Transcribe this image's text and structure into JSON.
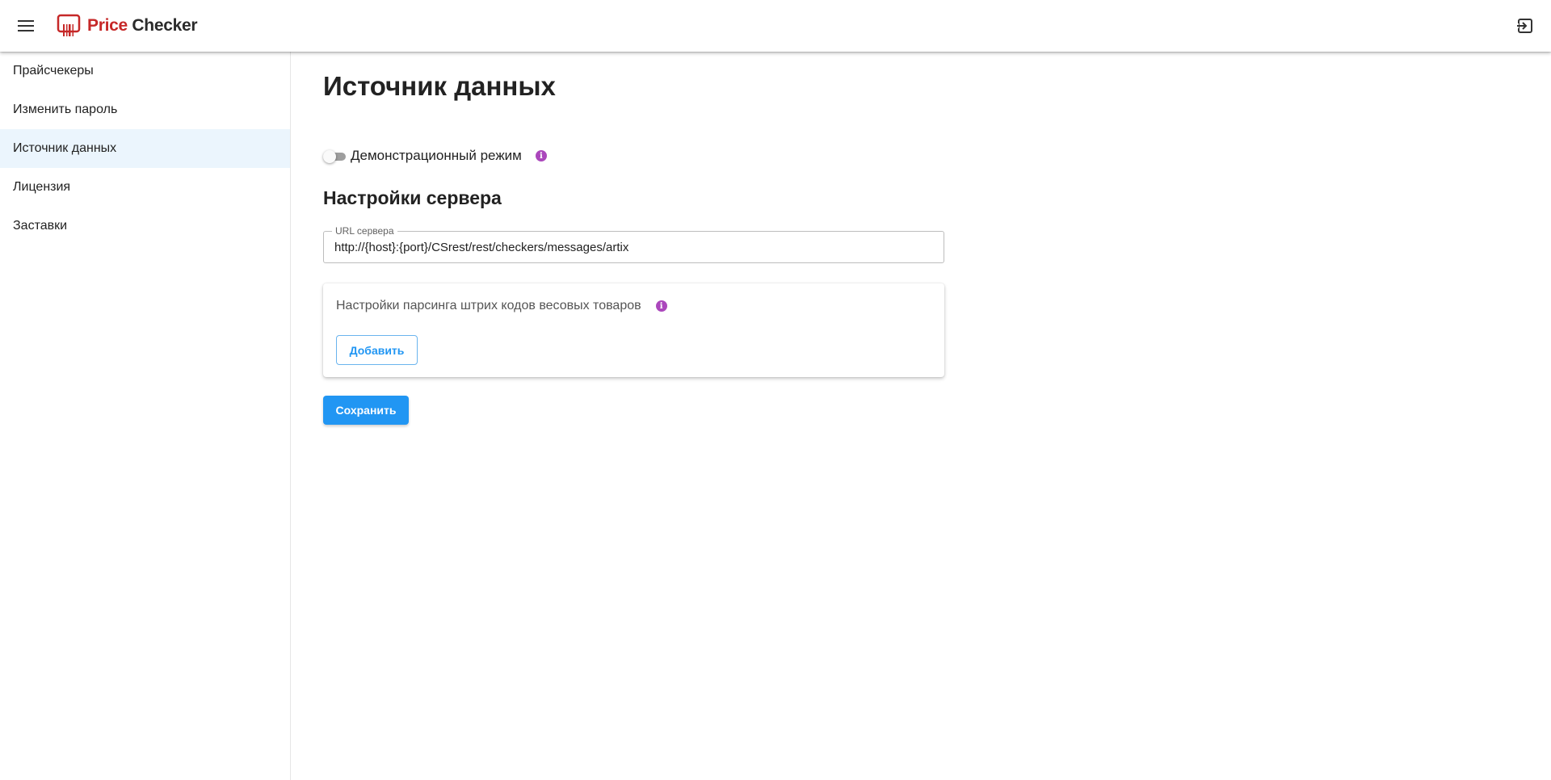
{
  "header": {
    "logo_price": "Price",
    "logo_checker": "Checker",
    "menu_icon": "hamburger-menu-icon",
    "logout_icon": "logout-icon",
    "brand_color": "#c62828"
  },
  "sidebar": {
    "items": [
      {
        "label": "Прайсчекеры",
        "active": false
      },
      {
        "label": "Изменить пароль",
        "active": false
      },
      {
        "label": "Источник данных",
        "active": true
      },
      {
        "label": "Лицензия",
        "active": false
      },
      {
        "label": "Заставки",
        "active": false
      }
    ],
    "active_bg": "#ebf5fd"
  },
  "main": {
    "title": "Источник данных",
    "demo_mode": {
      "label": "Демонстрационный режим",
      "enabled": false,
      "info_icon": "info-icon"
    },
    "server_settings": {
      "title": "Настройки сервера",
      "url_label": "URL сервера",
      "url_value": "http://{host}:{port}/CSrest/rest/checkers/messages/artix"
    },
    "barcode_parsing": {
      "title": "Настройки парсинга штрих кодов весовых товаров",
      "info_icon": "info-icon",
      "add_label": "Добавить"
    },
    "save_label": "Сохранить"
  },
  "colors": {
    "primary": "#2196f3",
    "info": "#ab47bc"
  }
}
